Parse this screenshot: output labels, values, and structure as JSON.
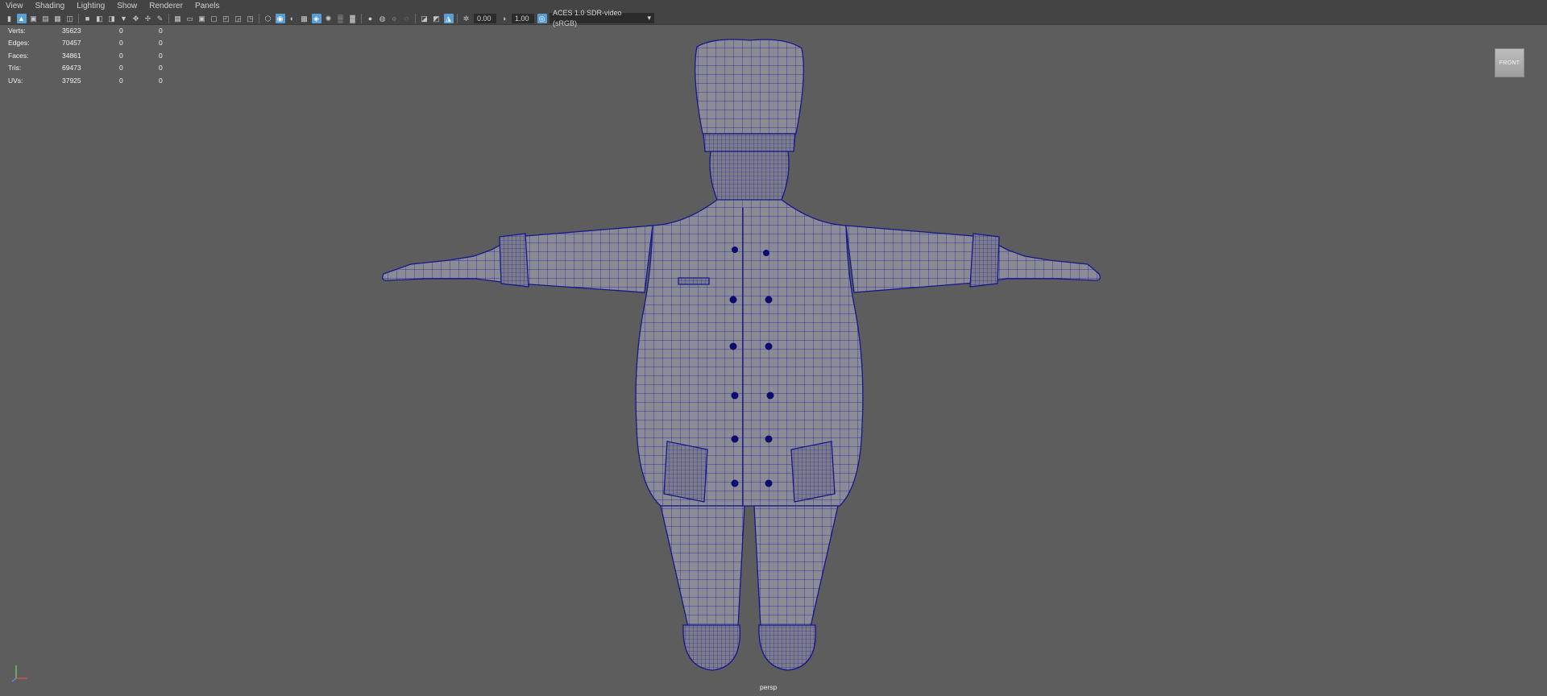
{
  "menu": [
    "View",
    "Shading",
    "Lighting",
    "Show",
    "Renderer",
    "Panels"
  ],
  "toolbar": {
    "exposure_value": "0.00",
    "gamma_value": "1.00",
    "color_space": "ACES 1.0 SDR-video (sRGB)"
  },
  "hud": {
    "rows": [
      {
        "label": "Verts:",
        "value": "35623",
        "selected": "0",
        "components": "0"
      },
      {
        "label": "Edges:",
        "value": "70457",
        "selected": "0",
        "components": "0"
      },
      {
        "label": "Faces:",
        "value": "34861",
        "selected": "0",
        "components": "0"
      },
      {
        "label": "Tris:",
        "value": "69473",
        "selected": "0",
        "components": "0"
      },
      {
        "label": "UVs:",
        "value": "37925",
        "selected": "0",
        "components": "0"
      }
    ]
  },
  "viewcube": {
    "face": "FRONT"
  },
  "camera": {
    "name": "persp"
  },
  "colors": {
    "viewport_bg": "#5d5d5d",
    "wireframe": "#1a1aa0",
    "mesh_shade": "#8a8a94",
    "active_icon": "#5a9ed6"
  },
  "icons": [
    "select-icon",
    "lasso-icon",
    "paint-icon",
    "grid-icon",
    "camera-icon",
    "bookmark-icon",
    "image-plane-icon",
    "wireframe-icon",
    "smooth-shade-icon",
    "texture-icon",
    "light-icon",
    "shadow-icon",
    "isolate-icon",
    "xray-icon",
    "exposure-icon",
    "gamma-icon",
    "color-management-icon"
  ]
}
